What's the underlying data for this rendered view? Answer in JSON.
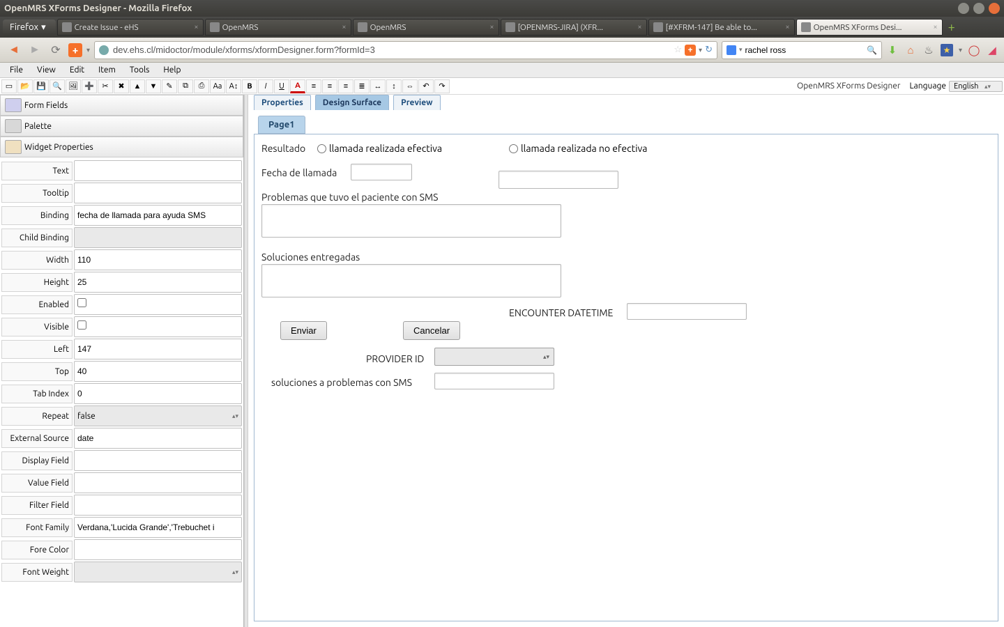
{
  "window": {
    "title": "OpenMRS XForms Designer - Mozilla Firefox"
  },
  "browser": {
    "menu_button": "Firefox",
    "tabs": [
      {
        "label": "Create Issue - eHS",
        "active": false
      },
      {
        "label": "OpenMRS",
        "active": false
      },
      {
        "label": "OpenMRS",
        "active": false
      },
      {
        "label": "[OPENMRS-JIRA] (XFR...",
        "active": false
      },
      {
        "label": "[#XFRM-147] Be able to...",
        "active": false
      },
      {
        "label": "OpenMRS XForms Desi...",
        "active": true
      }
    ],
    "url": "dev.ehs.cl/midoctor/module/xforms/xformDesigner.form?formId=3",
    "search_value": "rachel ross"
  },
  "menubar": [
    "File",
    "View",
    "Edit",
    "Item",
    "Tools",
    "Help"
  ],
  "designer": {
    "title": "OpenMRS XForms Designer",
    "language_label": "Language",
    "language_value": "English"
  },
  "left_panel": {
    "sections": {
      "form_fields": "Form Fields",
      "palette": "Palette",
      "widget_props": "Widget Properties"
    },
    "properties": [
      {
        "label": "Text",
        "value": "",
        "type": "text"
      },
      {
        "label": "Tooltip",
        "value": "",
        "type": "text"
      },
      {
        "label": "Binding",
        "value": "fecha de llamada para ayuda SMS",
        "type": "text"
      },
      {
        "label": "Child Binding",
        "value": "",
        "type": "readonly"
      },
      {
        "label": "Width",
        "value": "110",
        "type": "text"
      },
      {
        "label": "Height",
        "value": "25",
        "type": "text"
      },
      {
        "label": "Enabled",
        "value": "",
        "type": "checkbox"
      },
      {
        "label": "Visible",
        "value": "",
        "type": "checkbox"
      },
      {
        "label": "Left",
        "value": "147",
        "type": "text"
      },
      {
        "label": "Top",
        "value": "40",
        "type": "text"
      },
      {
        "label": "Tab Index",
        "value": "0",
        "type": "text"
      },
      {
        "label": "Repeat",
        "value": "false",
        "type": "select-ro"
      },
      {
        "label": "External Source",
        "value": "date",
        "type": "text"
      },
      {
        "label": "Display Field",
        "value": "",
        "type": "text"
      },
      {
        "label": "Value Field",
        "value": "",
        "type": "text"
      },
      {
        "label": "Filter Field",
        "value": "",
        "type": "text"
      },
      {
        "label": "Font Family",
        "value": "Verdana,'Lucida Grande','Trebuchet i",
        "type": "text"
      },
      {
        "label": "Fore Color",
        "value": "",
        "type": "text"
      },
      {
        "label": "Font Weight",
        "value": "",
        "type": "select-ro"
      }
    ]
  },
  "design_tabs": [
    {
      "label": "Properties",
      "active": false
    },
    {
      "label": "Design Surface",
      "active": true
    },
    {
      "label": "Preview",
      "active": false
    }
  ],
  "page_tab": "Page1",
  "canvas": {
    "labels": {
      "resultado": "Resultado",
      "radio1": "llamada realizada efectiva",
      "radio2": "llamada realizada no efectiva",
      "fecha": "Fecha de llamada",
      "problemas": "Problemas que tuvo el paciente con SMS",
      "soluciones": "Soluciones entregadas",
      "encounter": "ENCOUNTER DATETIME",
      "enviar": "Enviar",
      "cancelar": "Cancelar",
      "provider": "PROVIDER ID",
      "sol_problemas": "soluciones a problemas con SMS"
    }
  },
  "toolbar_icons": [
    "new",
    "open",
    "save",
    "find",
    "image",
    "add",
    "cut",
    "delete",
    "up",
    "down",
    "brush",
    "copy",
    "paste",
    "font",
    "font-size",
    "bold",
    "italic",
    "underline",
    "color",
    "align-left",
    "align-center",
    "align-right",
    "justify",
    "hrule",
    "height",
    "width",
    "undo",
    "redo"
  ]
}
